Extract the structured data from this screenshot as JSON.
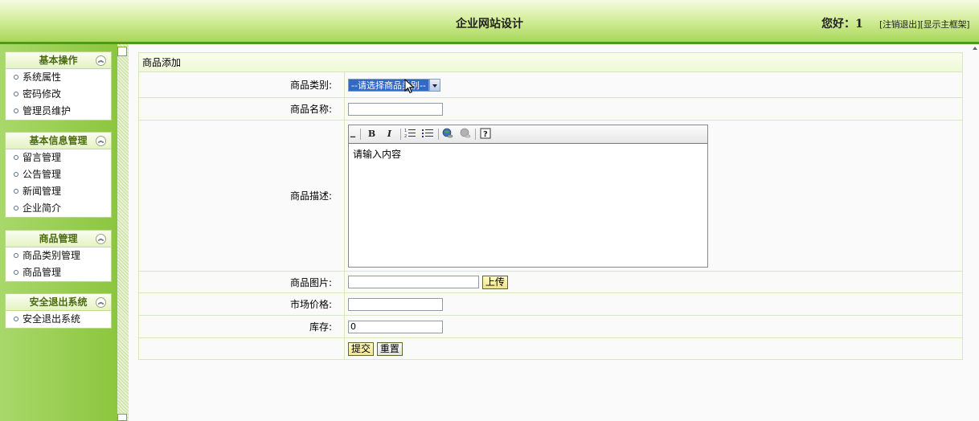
{
  "header": {
    "title": "企业网站设计",
    "greeting": "您好：1",
    "logout_link": "[注销退出]",
    "frame_link": "[显示主框架]"
  },
  "sidebar": {
    "groups": [
      {
        "title": "基本操作",
        "items": [
          "系统属性",
          "密码修改",
          "管理员维护"
        ]
      },
      {
        "title": "基本信息管理",
        "items": [
          "留言管理",
          "公告管理",
          "新闻管理",
          "企业简介"
        ]
      },
      {
        "title": "商品管理",
        "items": [
          "商品类别管理",
          "商品管理"
        ]
      },
      {
        "title": "安全退出系统",
        "items": [
          "安全退出系统"
        ]
      }
    ]
  },
  "form": {
    "caption": "商品添加",
    "category_label": "商品类别:",
    "category_selected": "--请选择商品类别--",
    "name_label": "商品名称:",
    "name_value": "",
    "desc_label": "商品描述:",
    "desc_placeholder": "请输入内容",
    "image_label": "商品图片:",
    "image_value": "",
    "upload_button": "上传",
    "price_label": "市场价格:",
    "price_value": "",
    "stock_label": "库存:",
    "stock_value": "0",
    "submit_button": "提交",
    "reset_button": "重置"
  },
  "editor_toolbar": {
    "bold": "B",
    "italic": "I",
    "help": "?"
  },
  "colors": {
    "header_border": "#4e9a12",
    "sidebar_bg": "#8cc63e",
    "selection_blue": "#3169c6",
    "menu_title": "#4a6b10"
  }
}
